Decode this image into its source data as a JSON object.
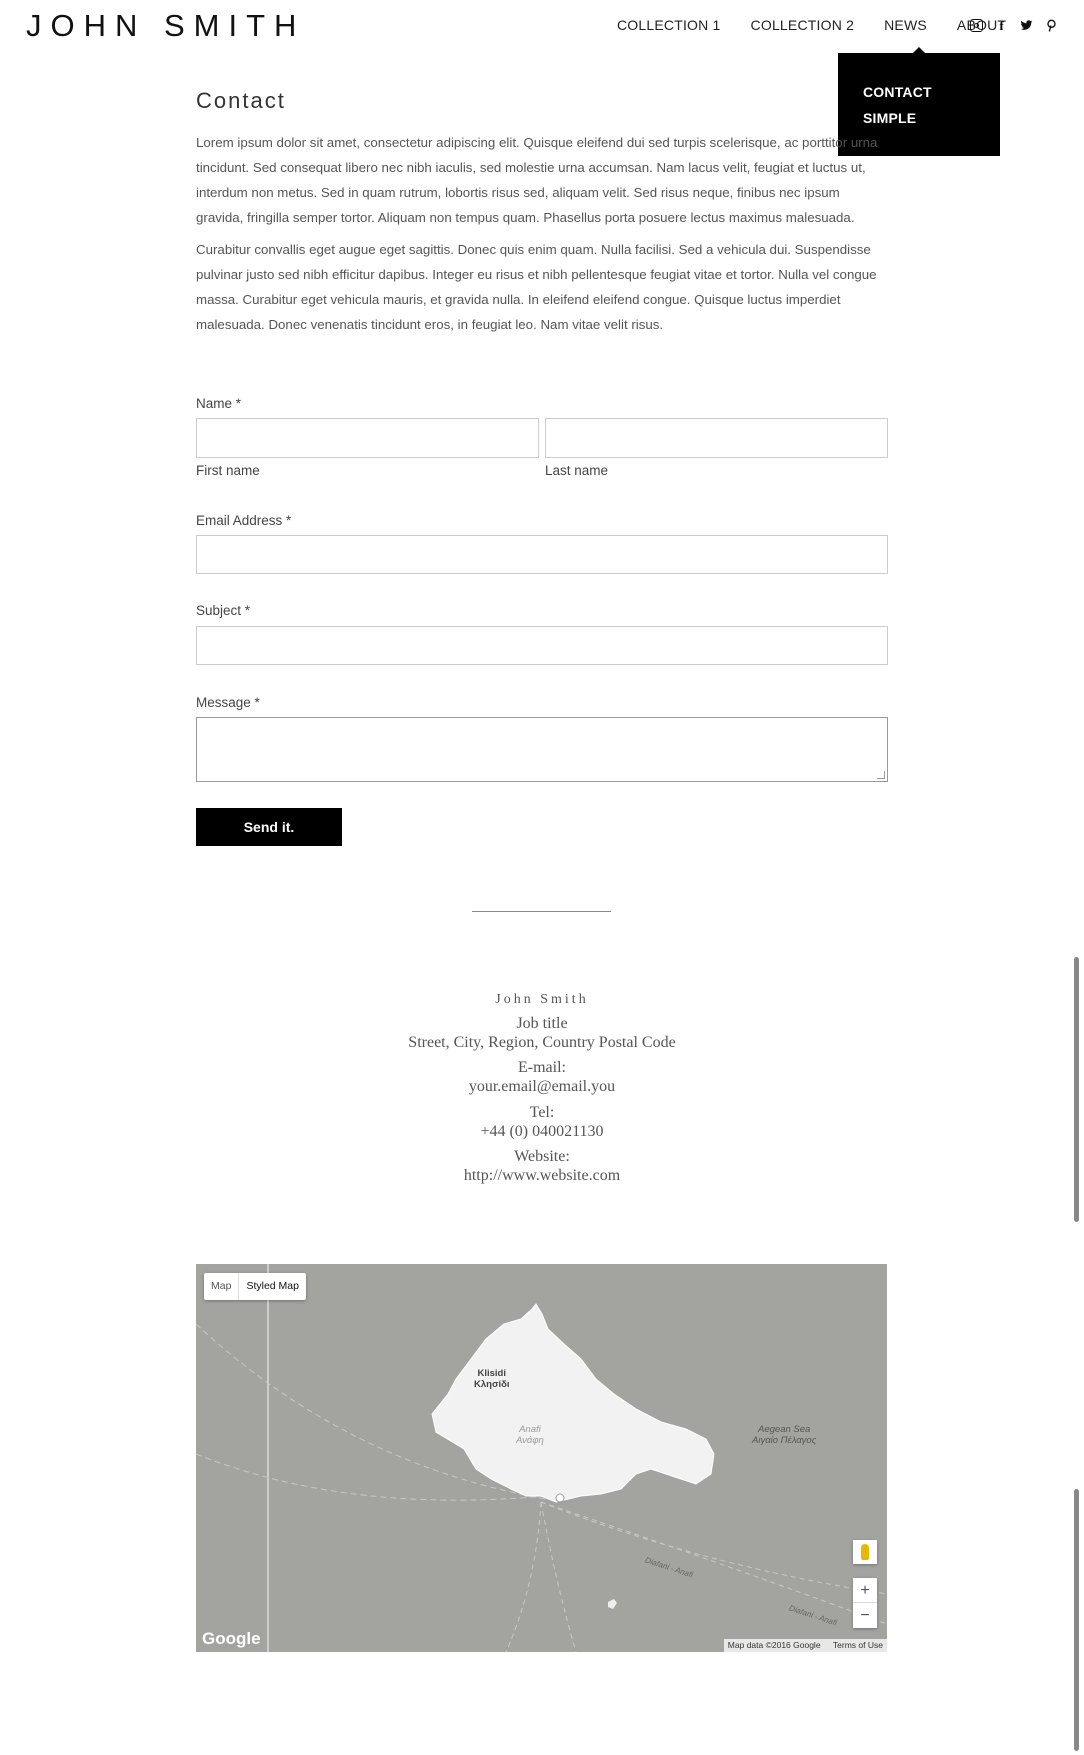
{
  "header": {
    "logo": "JOHN SMITH",
    "nav": [
      "COLLECTION 1",
      "COLLECTION 2",
      "NEWS",
      "ABOUT"
    ],
    "social_icons": [
      "instagram-icon",
      "facebook-icon",
      "twitter-icon",
      "pinterest-icon"
    ],
    "dropdown": [
      "CONTACT",
      "SIMPLE"
    ]
  },
  "page": {
    "title": "Contact",
    "paragraphs": [
      "Lorem ipsum dolor sit amet, consectetur adipiscing elit. Quisque eleifend dui sed turpis scelerisque, ac porttitor urna tincidunt. Sed consequat libero nec nibh iaculis, sed molestie urna accumsan. Nam lacus velit, feugiat et luctus ut, interdum non metus. Sed in quam rutrum, lobortis risus sed, aliquam velit. Sed risus neque, finibus nec ipsum gravida, fringilla semper tortor. Aliquam non tempus quam. Phasellus porta posuere lectus maximus malesuada.",
      "Curabitur convallis eget augue eget sagittis. Donec quis enim quam. Nulla facilisi. Sed a vehicula dui. Suspendisse pulvinar justo sed nibh efficitur dapibus. Integer eu risus et nibh pellentesque feugiat vitae et tortor. Nulla vel congue massa. Curabitur eget vehicula mauris, et gravida nulla. In eleifend eleifend congue. Quisque luctus imperdiet malesuada. Donec venenatis tincidunt eros, in feugiat leo. Nam vitae velit risus."
    ]
  },
  "form": {
    "name_label": "Name *",
    "first_name": "First name",
    "last_name": "Last name",
    "email_label": "Email Address *",
    "subject_label": "Subject *",
    "message_label": "Message *",
    "submit": "Send it."
  },
  "contact_card": {
    "name": "John Smith",
    "job_title": "Job title",
    "address": "Street, City, Region, Country Postal Code",
    "email_label": "E-mail:",
    "email": "your.email@email.you",
    "tel_label": "Tel:",
    "tel": "+44 (0) 040021130",
    "website_label": "Website:",
    "website": "http://www.website.com"
  },
  "map": {
    "type_map": "Map",
    "type_styled": "Styled Map",
    "labels": {
      "klisidi": "Klisidi",
      "klisidi_gr": "Κλησίδι",
      "anafi": "Anafi",
      "anafi_gr": "Ανάφη",
      "aegean": "Aegean Sea",
      "aegean_gr": "Αιγαίο Πέλαγος",
      "ferry1": "Diafani - Anafi",
      "ferry2": "Diafani - Anafi"
    },
    "zoom_in": "+",
    "zoom_out": "−",
    "logo": "Google",
    "attribution": "Map data ©2016 Google",
    "terms": "Terms of Use"
  }
}
